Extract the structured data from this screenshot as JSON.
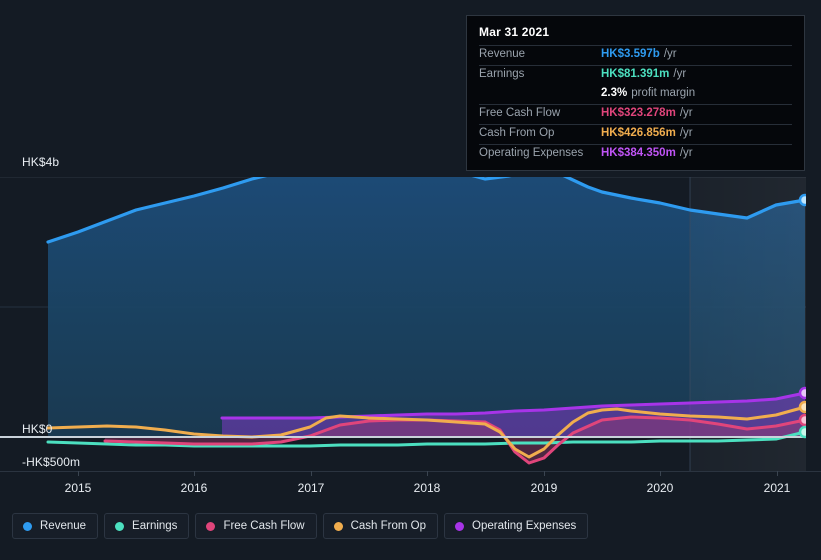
{
  "theme": {
    "background": "#141b24",
    "plot_background_left": "#141b24",
    "gridline": "#2b3440",
    "zero_line": "#c9d2da",
    "axis_text": "#e8edf2",
    "tooltip_background": "#05070b",
    "tooltip_border": "#2e3640",
    "tooltip_label": "#9aa3ad"
  },
  "tooltip": {
    "date": "Mar 31 2021",
    "rows": [
      {
        "label": "Revenue",
        "value": "HK$3.597b",
        "unit": "/yr",
        "color": "#2e9bf0"
      },
      {
        "label": "Earnings",
        "value": "HK$81.391m",
        "unit": "/yr",
        "color": "#4ce0c0"
      },
      {
        "label": "Free Cash Flow",
        "value": "HK$323.278m",
        "unit": "/yr",
        "color": "#e0457b"
      },
      {
        "label": "Cash From Op",
        "value": "HK$426.856m",
        "unit": "/yr",
        "color": "#f0ad4e"
      },
      {
        "label": "Operating Expenses",
        "value": "HK$384.350m",
        "unit": "/yr",
        "color": "#a734e8"
      }
    ],
    "margin_value": "2.3%",
    "margin_label": "profit margin"
  },
  "legend": {
    "items": [
      {
        "label": "Revenue",
        "color": "#2e9bf0"
      },
      {
        "label": "Earnings",
        "color": "#4ce0c0"
      },
      {
        "label": "Free Cash Flow",
        "color": "#e0457b"
      },
      {
        "label": "Cash From Op",
        "color": "#f0ad4e"
      },
      {
        "label": "Operating Expenses",
        "color": "#a734e8"
      }
    ]
  },
  "axes": {
    "y_labels": [
      {
        "text": "HK$4b",
        "value": 4000
      },
      {
        "text": "HK$0",
        "value": 0
      },
      {
        "text": "-HK$500m",
        "value": -500
      }
    ],
    "x_labels": [
      "2015",
      "2016",
      "2017",
      "2018",
      "2019",
      "2020",
      "2021"
    ]
  },
  "chart_data": {
    "type": "area",
    "title": "",
    "xlabel": "",
    "ylabel": "",
    "currency": "HK$",
    "units": "millions",
    "ylim": [
      -500,
      4400
    ],
    "xlim": [
      2014.7,
      2021.25
    ],
    "grid": true,
    "gridlines_y": [
      4000,
      2000,
      0
    ],
    "zero_line": 0,
    "legend_position": "bottom-left",
    "forecast_divider_x": 2020.25,
    "x": [
      2014.74,
      2015.0,
      2015.5,
      2016.0,
      2016.5,
      2017.0,
      2017.35,
      2017.75,
      2018.0,
      2018.5,
      2019.0,
      2019.4,
      2019.75,
      2020.0,
      2020.5,
      2020.9,
      2021.24
    ],
    "series": [
      {
        "name": "Revenue",
        "color": "#2e9bf0",
        "fill": true,
        "values": [
          2700,
          2800,
          3030,
          3180,
          3370,
          3500,
          3560,
          3680,
          3680,
          3570,
          3420,
          3450,
          3530,
          3400,
          3290,
          3250,
          3597
        ]
      },
      {
        "name": "Earnings",
        "color": "#4ce0c0",
        "fill": false,
        "values": [
          -95,
          -100,
          -110,
          -115,
          -120,
          -120,
          -118,
          -112,
          -110,
          -108,
          -105,
          -102,
          -100,
          -98,
          -96,
          -94,
          81
        ]
      },
      {
        "name": "Free Cash Flow",
        "color": "#e0457b",
        "fill": true,
        "values": [
          -60,
          -62,
          -75,
          -90,
          -100,
          -105,
          -40,
          130,
          155,
          150,
          -310,
          -120,
          240,
          255,
          230,
          120,
          323
        ]
      },
      {
        "name": "Cash From Op",
        "color": "#f0ad4e",
        "fill": false,
        "values": [
          35,
          40,
          45,
          30,
          10,
          -5,
          60,
          195,
          175,
          165,
          -210,
          50,
          330,
          300,
          250,
          230,
          427
        ]
      },
      {
        "name": "Operating Expenses",
        "color": "#a734e8",
        "fill": true,
        "values": [
          null,
          null,
          null,
          195,
          190,
          190,
          190,
          200,
          205,
          210,
          215,
          225,
          250,
          255,
          260,
          265,
          384
        ]
      }
    ]
  }
}
